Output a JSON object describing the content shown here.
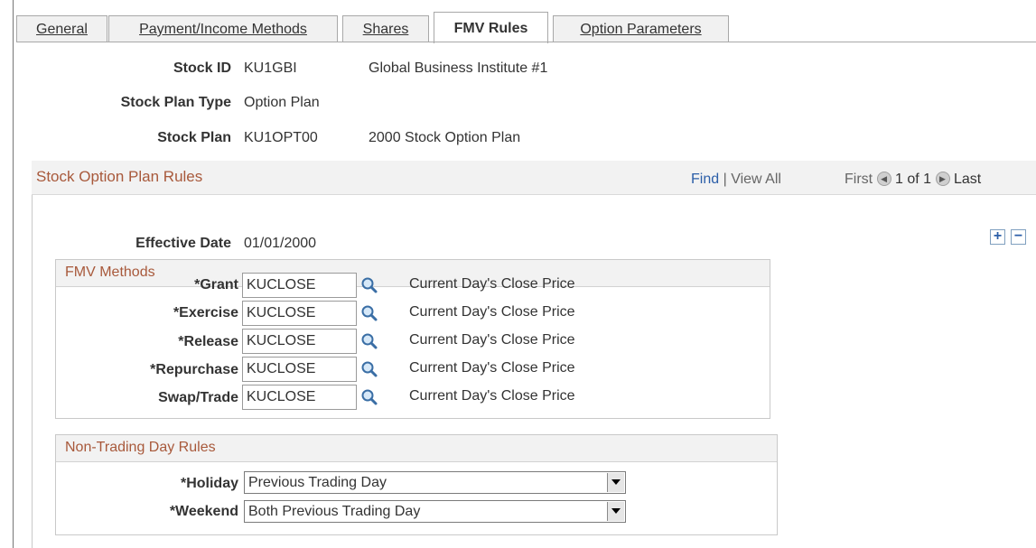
{
  "tabs": [
    {
      "label": "General",
      "active": false
    },
    {
      "label": "Payment/Income Methods",
      "active": false
    },
    {
      "label": "Shares",
      "active": false
    },
    {
      "label": "FMV Rules",
      "active": true
    },
    {
      "label": "Option Parameters",
      "active": false
    }
  ],
  "header": {
    "stock_id_label": "Stock ID",
    "stock_id_value": "KU1GBI",
    "stock_id_desc": "Global Business Institute #1",
    "plan_type_label": "Stock Plan Type",
    "plan_type_value": "Option Plan",
    "stock_plan_label": "Stock Plan",
    "stock_plan_value": "KU1OPT00",
    "stock_plan_desc": "2000 Stock Option Plan"
  },
  "rules": {
    "title": "Stock Option Plan Rules",
    "find": "Find",
    "separator": "|",
    "view_all": "View All",
    "first": "First",
    "count": "1 of 1",
    "last": "Last",
    "effective_date_label": "Effective Date",
    "effective_date_value": "01/01/2000",
    "add_label": "+",
    "remove_label": "−"
  },
  "fmv_methods": {
    "title": "FMV Methods",
    "rows": [
      {
        "label": "*Grant",
        "value": "KUCLOSE",
        "desc": "Current Day's Close Price"
      },
      {
        "label": "*Exercise",
        "value": "KUCLOSE",
        "desc": "Current Day's Close Price"
      },
      {
        "label": "*Release",
        "value": "KUCLOSE",
        "desc": "Current Day's Close Price"
      },
      {
        "label": "*Repurchase",
        "value": "KUCLOSE",
        "desc": "Current Day's Close Price"
      },
      {
        "label": "Swap/Trade",
        "value": "KUCLOSE",
        "desc": "Current Day's Close Price"
      }
    ]
  },
  "non_trading": {
    "title": "Non-Trading Day Rules",
    "holiday_label": "*Holiday",
    "holiday_value": "Previous Trading Day",
    "weekend_label": "*Weekend",
    "weekend_value": "Both Previous Trading Day"
  },
  "colors": {
    "section_title": "#a8593b",
    "link": "#2b5ea8"
  }
}
